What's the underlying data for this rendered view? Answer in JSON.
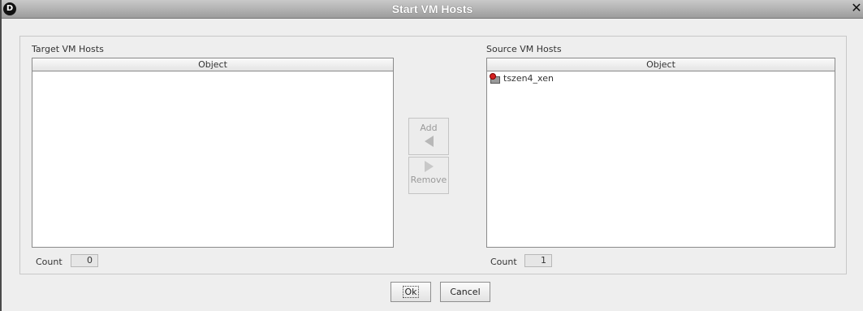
{
  "window": {
    "title": "Start VM Hosts",
    "app_icon_letter": "D",
    "close_glyph": "✕"
  },
  "target": {
    "label": "Target VM Hosts",
    "column_header": "Object",
    "rows": [],
    "count_label": "Count",
    "count_value": "0"
  },
  "source": {
    "label": "Source VM Hosts",
    "column_header": "Object",
    "rows": [
      {
        "name": "tszen4_xen",
        "icon": "vm-host-icon"
      }
    ],
    "count_label": "Count",
    "count_value": "1"
  },
  "transfer": {
    "add_label": "Add",
    "remove_label": "Remove",
    "add_icon": "arrow-left-icon",
    "remove_icon": "arrow-right-icon",
    "enabled": false
  },
  "buttons": {
    "ok_label": "Ok",
    "cancel_label": "Cancel"
  },
  "colors": {
    "titlebar": "#9c9c9c",
    "panel_bg": "#eeeeee",
    "badge_red": "#d42020"
  }
}
